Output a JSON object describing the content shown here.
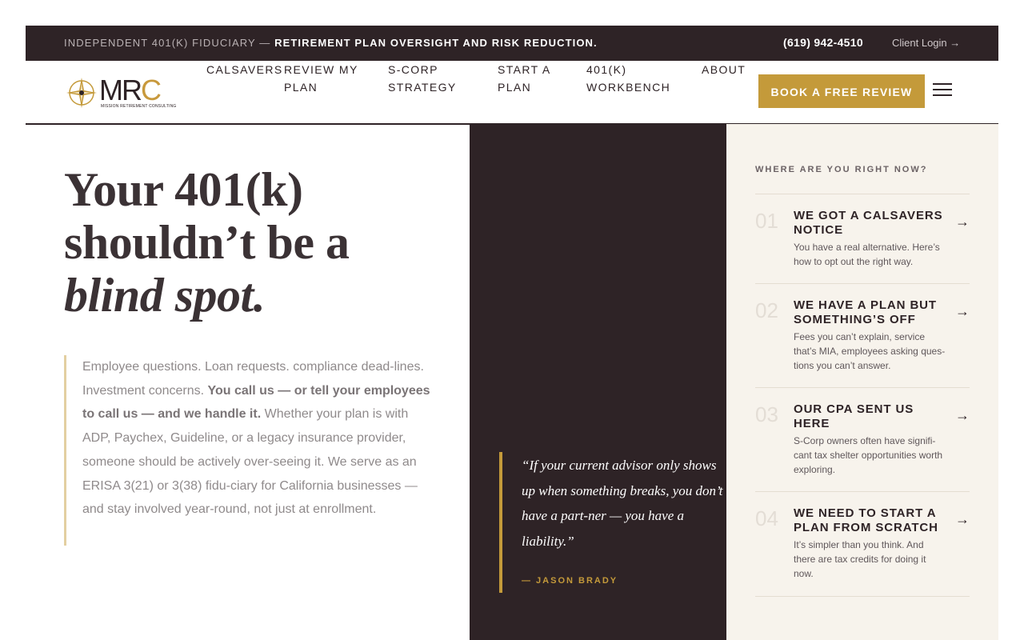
{
  "topbar": {
    "tagline_muted": "INDEPENDENT 401(K) FIDUCIARY —",
    "tagline_strong": "RETIREMENT PLAN OVERSIGHT AND RISK REDUCTION.",
    "phone": "(619) 942-4510",
    "login": "Client Login →"
  },
  "logo": {
    "word_main": "MR",
    "word_accent": "C",
    "sub": "MISSION RETIREMENT CONSULTING"
  },
  "nav": {
    "items": [
      "CALSAVERS",
      "REVIEW MY PLAN",
      "S-CORP STRATEGY",
      "START A PLAN",
      "401(K) WORKBENCH",
      "ABOUT"
    ]
  },
  "cta": {
    "label": "BOOK A FREE REVIEW"
  },
  "hero": {
    "line1": "Your 401(k)",
    "line2": "shouldn’t be a",
    "line3": "blind spot."
  },
  "intro": {
    "part1": "Employee questions. Loan requests. compliance dead-lines. Investment concerns. ",
    "bold": "You call us — or tell your employees to call us — and we handle it.",
    "part2": " Whether your plan is with ADP, Paychex, Guideline, or a legacy insurance provider, someone should be actively over-seeing it. We serve as an ERISA 3(21) or 3(38) fidu-ciary for California businesses — and stay involved year-round, not just at enrollment."
  },
  "quote": {
    "text": "“If your current advisor only shows up when something breaks, you don’t have a part-ner — you have a liability.”",
    "author": "— JASON BRADY"
  },
  "options": {
    "heading": "WHERE ARE YOU RIGHT NOW?",
    "items": [
      {
        "num": "01",
        "title": "WE GOT A CALSAVERS NOTICE",
        "desc": "You have a real alternative. Here’s how to opt out the right way.",
        "arrow": "→"
      },
      {
        "num": "02",
        "title": "WE HAVE A PLAN BUT SOMETHING’S OFF",
        "desc": "Fees you can’t explain, service that’s MIA, employees asking ques-tions you can’t answer.",
        "arrow": "→"
      },
      {
        "num": "03",
        "title": "OUR CPA SENT US HERE",
        "desc": "S-Corp owners often have signifi-cant tax shelter opportunities worth exploring.",
        "arrow": "→"
      },
      {
        "num": "04",
        "title": "WE NEED TO START A PLAN FROM SCRATCH",
        "desc": "It’s simpler than you think. And there are tax credits for doing it now.",
        "arrow": "→"
      }
    ]
  },
  "colors": {
    "dark": "#2e2326",
    "gold": "#c49a3a",
    "cream": "#f7f3ec"
  }
}
